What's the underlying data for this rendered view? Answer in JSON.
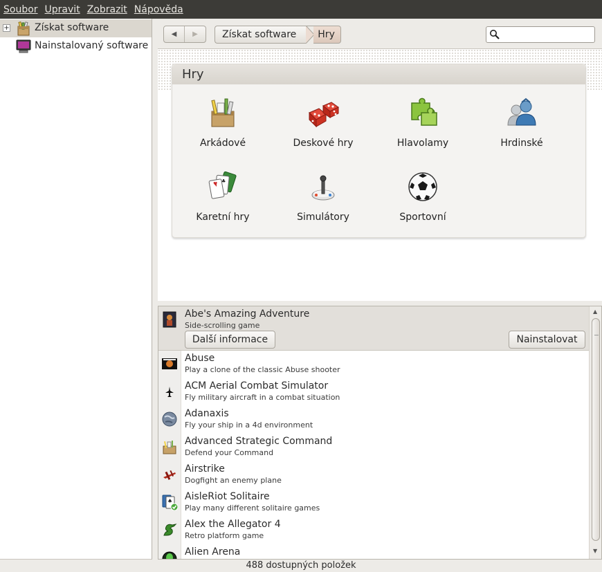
{
  "menu": [
    "Soubor",
    "Upravit",
    "Zobrazit",
    "Nápověda"
  ],
  "sidebar": {
    "items": [
      {
        "label": "Získat software",
        "icon": "software-center-icon",
        "selected": true
      },
      {
        "label": "Nainstalovaný software",
        "icon": "monitor-icon",
        "selected": false
      }
    ],
    "expander": "+"
  },
  "toolbar": {
    "back": "◀",
    "forward": "▶",
    "breadcrumb": [
      "Získat software",
      "Hry"
    ],
    "search_value": ""
  },
  "category_panel": {
    "title": "Hry",
    "categories": [
      {
        "label": "Arkádové",
        "icon": "arcade-box-icon"
      },
      {
        "label": "Deskové hry",
        "icon": "dice-icon"
      },
      {
        "label": "Hlavolamy",
        "icon": "puzzle-icon"
      },
      {
        "label": "Hrdinské",
        "icon": "role-playing-icon"
      },
      {
        "label": "Karetní hry",
        "icon": "cards-icon"
      },
      {
        "label": "Simulátory",
        "icon": "joystick-icon"
      },
      {
        "label": "Sportovní",
        "icon": "soccer-ball-icon"
      }
    ]
  },
  "app_list": {
    "selected": {
      "name": "Abe's Amazing Adventure",
      "desc": "Side-scrolling game",
      "more_info_label": "Další informace",
      "install_label": "Nainstalovat"
    },
    "items": [
      {
        "name": "Abuse",
        "desc": "Play a clone of the classic Abuse shooter",
        "icon": "abuse-icon"
      },
      {
        "name": "ACM Aerial Combat Simulator",
        "desc": "Fly military aircraft in a combat situation",
        "icon": "jet-icon"
      },
      {
        "name": "Adanaxis",
        "desc": "Fly your ship in a 4d environment",
        "icon": "planet-icon"
      },
      {
        "name": "Advanced Strategic Command",
        "desc": "Defend your Command",
        "icon": "strategy-box-icon"
      },
      {
        "name": "Airstrike",
        "desc": "Dogfight an enemy plane",
        "icon": "biplane-icon"
      },
      {
        "name": "AisleRiot Solitaire",
        "desc": "Play many different solitaire games",
        "icon": "solitaire-installed-icon"
      },
      {
        "name": "Alex the Allegator 4",
        "desc": "Retro platform game",
        "icon": "alligator-icon"
      },
      {
        "name": "Alien Arena",
        "desc": "",
        "icon": "alien-icon"
      }
    ]
  },
  "status": {
    "text": "488 dostupných položek"
  }
}
